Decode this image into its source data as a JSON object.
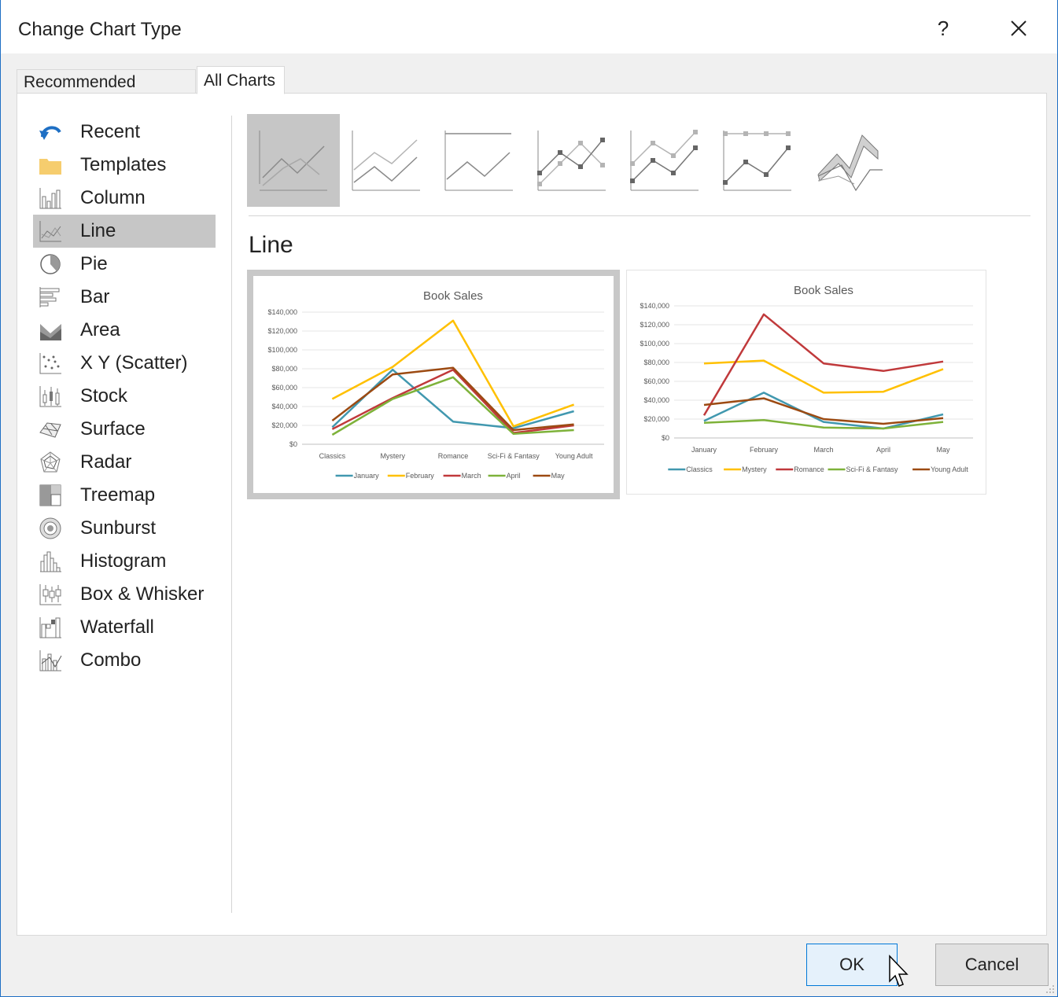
{
  "dialog": {
    "title": "Change Chart Type",
    "help_label": "?"
  },
  "tabs": [
    {
      "label": "Recommended Charts",
      "active": false
    },
    {
      "label": "All Charts",
      "active": true
    }
  ],
  "sidebar": {
    "items": [
      {
        "label": "Recent",
        "icon": "recent-icon"
      },
      {
        "label": "Templates",
        "icon": "folder-icon"
      },
      {
        "label": "Column",
        "icon": "column-chart-icon"
      },
      {
        "label": "Line",
        "icon": "line-chart-icon",
        "selected": true
      },
      {
        "label": "Pie",
        "icon": "pie-chart-icon"
      },
      {
        "label": "Bar",
        "icon": "bar-chart-icon"
      },
      {
        "label": "Area",
        "icon": "area-chart-icon"
      },
      {
        "label": "X Y (Scatter)",
        "icon": "scatter-chart-icon"
      },
      {
        "label": "Stock",
        "icon": "stock-chart-icon"
      },
      {
        "label": "Surface",
        "icon": "surface-chart-icon"
      },
      {
        "label": "Radar",
        "icon": "radar-chart-icon"
      },
      {
        "label": "Treemap",
        "icon": "treemap-chart-icon"
      },
      {
        "label": "Sunburst",
        "icon": "sunburst-chart-icon"
      },
      {
        "label": "Histogram",
        "icon": "histogram-chart-icon"
      },
      {
        "label": "Box & Whisker",
        "icon": "box-whisker-chart-icon"
      },
      {
        "label": "Waterfall",
        "icon": "waterfall-chart-icon"
      },
      {
        "label": "Combo",
        "icon": "combo-chart-icon"
      }
    ]
  },
  "subtypes": [
    {
      "name": "line",
      "selected": true
    },
    {
      "name": "stacked-line"
    },
    {
      "name": "100-stacked-line"
    },
    {
      "name": "line-with-markers"
    },
    {
      "name": "stacked-line-with-markers"
    },
    {
      "name": "100-stacked-line-with-markers"
    },
    {
      "name": "3d-line"
    }
  ],
  "section": {
    "title": "Line"
  },
  "colors": {
    "series": [
      "#4198af",
      "#ffc000",
      "#c0393b",
      "#7eb23a",
      "#9c4a12"
    ],
    "accent": "#0078d7"
  },
  "chart_data": [
    {
      "type": "line",
      "title": "Book Sales",
      "categories": [
        "Classics",
        "Mystery",
        "Romance",
        "Sci-Fi & Fantasy",
        "Young Adult"
      ],
      "y_ticks": [
        "$140,000",
        "$120,000",
        "$100,000",
        "$80,000",
        "$60,000",
        "$40,000",
        "$20,000",
        "$0"
      ],
      "ylim": [
        0,
        140000
      ],
      "grid": true,
      "legend": "bottom",
      "series": [
        {
          "name": "January",
          "values": [
            18000,
            79000,
            24000,
            17000,
            35000
          ]
        },
        {
          "name": "February",
          "values": [
            48000,
            82000,
            131000,
            19000,
            42000
          ]
        },
        {
          "name": "March",
          "values": [
            16000,
            49000,
            79000,
            12000,
            20000
          ]
        },
        {
          "name": "April",
          "values": [
            10000,
            48000,
            71000,
            11000,
            15000
          ]
        },
        {
          "name": "May",
          "values": [
            25000,
            74000,
            81000,
            15000,
            21000
          ]
        }
      ]
    },
    {
      "type": "line",
      "title": "Book Sales",
      "categories": [
        "January",
        "February",
        "March",
        "April",
        "May"
      ],
      "y_ticks": [
        "$140,000",
        "$120,000",
        "$100,000",
        "$80,000",
        "$60,000",
        "$40,000",
        "$20,000",
        "$0"
      ],
      "ylim": [
        0,
        140000
      ],
      "grid": true,
      "legend": "bottom",
      "series": [
        {
          "name": "Classics",
          "values": [
            18000,
            48000,
            17000,
            10000,
            25000
          ]
        },
        {
          "name": "Mystery",
          "values": [
            79000,
            82000,
            48000,
            49000,
            73000
          ]
        },
        {
          "name": "Romance",
          "values": [
            24000,
            131000,
            79000,
            71000,
            81000
          ]
        },
        {
          "name": "Sci-Fi & Fantasy",
          "values": [
            16000,
            19000,
            11000,
            10000,
            17000
          ]
        },
        {
          "name": "Young Adult",
          "values": [
            35000,
            42000,
            20000,
            15000,
            21000
          ]
        }
      ]
    }
  ],
  "buttons": {
    "ok": "OK",
    "cancel": "Cancel"
  }
}
